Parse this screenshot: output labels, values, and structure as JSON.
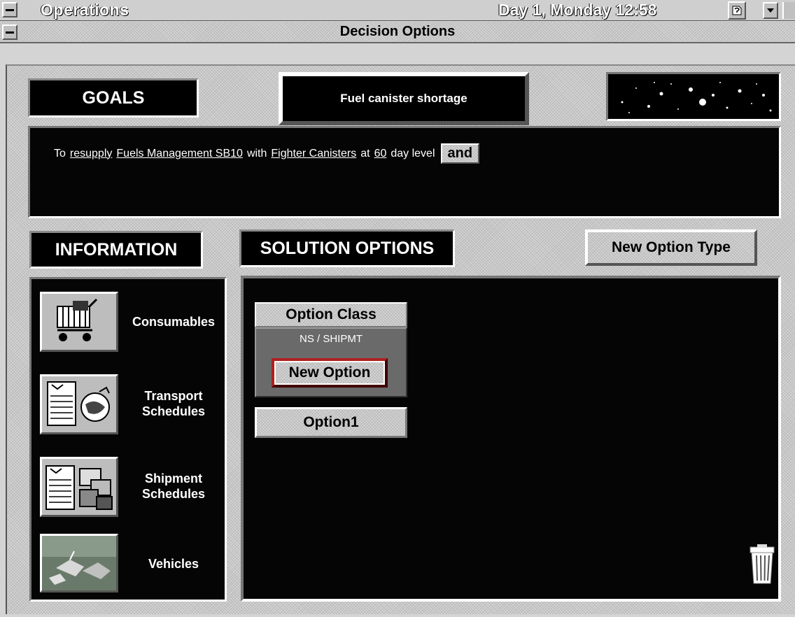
{
  "titlebar": {
    "app_title": "Operations",
    "clock": "Day 1, Monday 12:58"
  },
  "window": {
    "title": "Decision Options"
  },
  "goals": {
    "heading": "GOALS",
    "problem": "Fuel canister shortage",
    "statement": {
      "to": "To",
      "action": "resupply",
      "target": "Fuels Management SB10",
      "with": "with",
      "item": "Fighter Canisters",
      "at": "at",
      "level": "60",
      "suffix": "day level",
      "and_button": "and"
    }
  },
  "information": {
    "heading": "INFORMATION",
    "items": [
      {
        "label_line1": "Consumables",
        "label_line2": "",
        "icon": "shopping-cart-icon"
      },
      {
        "label_line1": "Transport",
        "label_line2": "Schedules",
        "icon": "transport-schedule-icon"
      },
      {
        "label_line1": "Shipment",
        "label_line2": "Schedules",
        "icon": "shipment-schedule-icon"
      },
      {
        "label_line1": "Vehicles",
        "label_line2": "",
        "icon": "vehicles-icon"
      }
    ]
  },
  "solutions": {
    "heading": "SOLUTION OPTIONS",
    "new_type_button": "New Option Type",
    "option_class": {
      "label": "Option Class",
      "type": "NS / SHIPMT",
      "new_option_button": "New Option"
    },
    "options": [
      "Option1"
    ],
    "trash_icon": "trash-can-icon"
  },
  "colors": {
    "panel": "#050505",
    "chrome": "#c8c8c8",
    "text_light": "#ffffff"
  }
}
